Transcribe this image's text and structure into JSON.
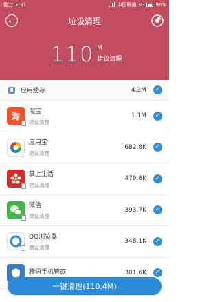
{
  "status_bar": {
    "time": "晚上11:31",
    "carrier": "中国联通 3G",
    "battery": "96%"
  },
  "header": {
    "title": "垃圾清理",
    "total_size": "110",
    "unit": "M",
    "subtitle": "建议清理"
  },
  "cache": {
    "label": "应用缓存",
    "size": "4.3M",
    "checked": true
  },
  "apps": [
    {
      "name": "淘宝",
      "sub": "建议清理",
      "size": "1.1M",
      "icon_color": "#f0522b",
      "icon_glyph": "淘",
      "checked": true
    },
    {
      "name": "应用宝",
      "sub": "建议清理",
      "size": "682.8K",
      "icon_color": "#ffffff",
      "icon_glyph": "",
      "checked": true
    },
    {
      "name": "掌上生活",
      "sub": "建议清理",
      "size": "479.8K",
      "icon_color": "#d92b27",
      "icon_glyph": "",
      "checked": true
    },
    {
      "name": "微信",
      "sub": "建议清理",
      "size": "393.7K",
      "icon_color": "#44b549",
      "icon_glyph": "",
      "checked": true
    },
    {
      "name": "QQ浏览器",
      "sub": "建议清理",
      "size": "348.1K",
      "icon_color": "#ffffff",
      "icon_glyph": "",
      "checked": true
    },
    {
      "name": "腾讯手机管家",
      "sub": "",
      "size": "301.6K",
      "icon_color": "#3a7cc8",
      "icon_glyph": "",
      "checked": true
    }
  ],
  "clean_button": {
    "label": "一键清理(110.4M)"
  },
  "colors": {
    "header_bg": "#c24c5f",
    "accent": "#2b8bd6"
  }
}
